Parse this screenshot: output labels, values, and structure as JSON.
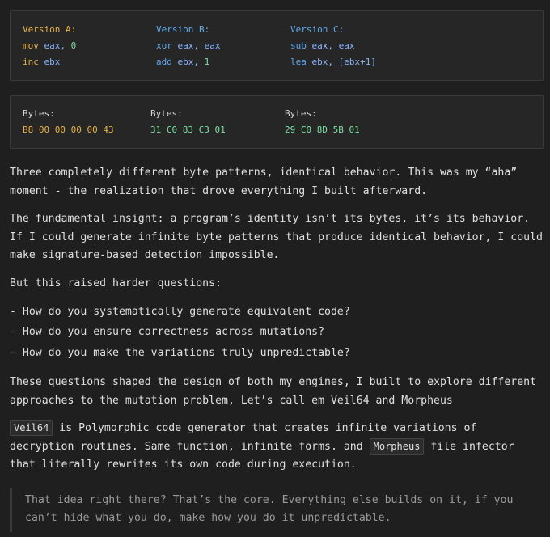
{
  "versions": [
    {
      "label": "Version A:",
      "line1_op": "mov",
      "line1_args": "eax,",
      "line1_val": "0",
      "line2_op": "inc",
      "line2_args": "ebx",
      "line2_val": ""
    },
    {
      "label": "Version B:",
      "line1_op": "xor",
      "line1_args": "eax, eax",
      "line1_val": "",
      "line2_op": "add",
      "line2_args": "ebx,",
      "line2_val": "1"
    },
    {
      "label": "Version C:",
      "line1_op": "sub",
      "line1_args": "eax, eax",
      "line1_val": "",
      "line2_op": "lea",
      "line2_args": "ebx, [ebx+1]",
      "line2_val": ""
    }
  ],
  "bytes": [
    {
      "label": "Bytes:",
      "hex": "B8 00 00 00 00 43"
    },
    {
      "label": "Bytes:",
      "hex": "31 C0 83 C3 01"
    },
    {
      "label": "Bytes:",
      "hex": "29 C0 8D 5B 01"
    }
  ],
  "paragraphs": {
    "p1": "Three completely different byte patterns, identical behavior. This was my “aha” moment - the realization that drove everything I built afterward.",
    "p2": "The fundamental insight: a program’s identity isn’t its bytes, it’s its behavior. If I could generate infinite byte patterns that produce identical behavior, I could make signature-based detection impossible.",
    "p3": "But this raised harder questions:",
    "b1": "- How do you systematically generate equivalent code?",
    "b2": "- How do you ensure correctness across mutations?",
    "b3": "- How do you make the variations truly unpredictable?",
    "p4": "These questions shaped the design of both my engines, I built to explore different approaches to the mutation problem, Let’s call em Veil64 and Morpheus",
    "p5_code1": "Veil64",
    "p5_a": " is Polymorphic code generator that creates infinite variations of decryption routines. Same function, infinite forms. and ",
    "p5_code2": "Morpheus",
    "p5_b": " file infector that literally rewrites its own code during execution."
  },
  "quote": "That idea right there? That’s the core. Everything else builds on it, if you can’t hide what you do, make how you do it unpredictable."
}
